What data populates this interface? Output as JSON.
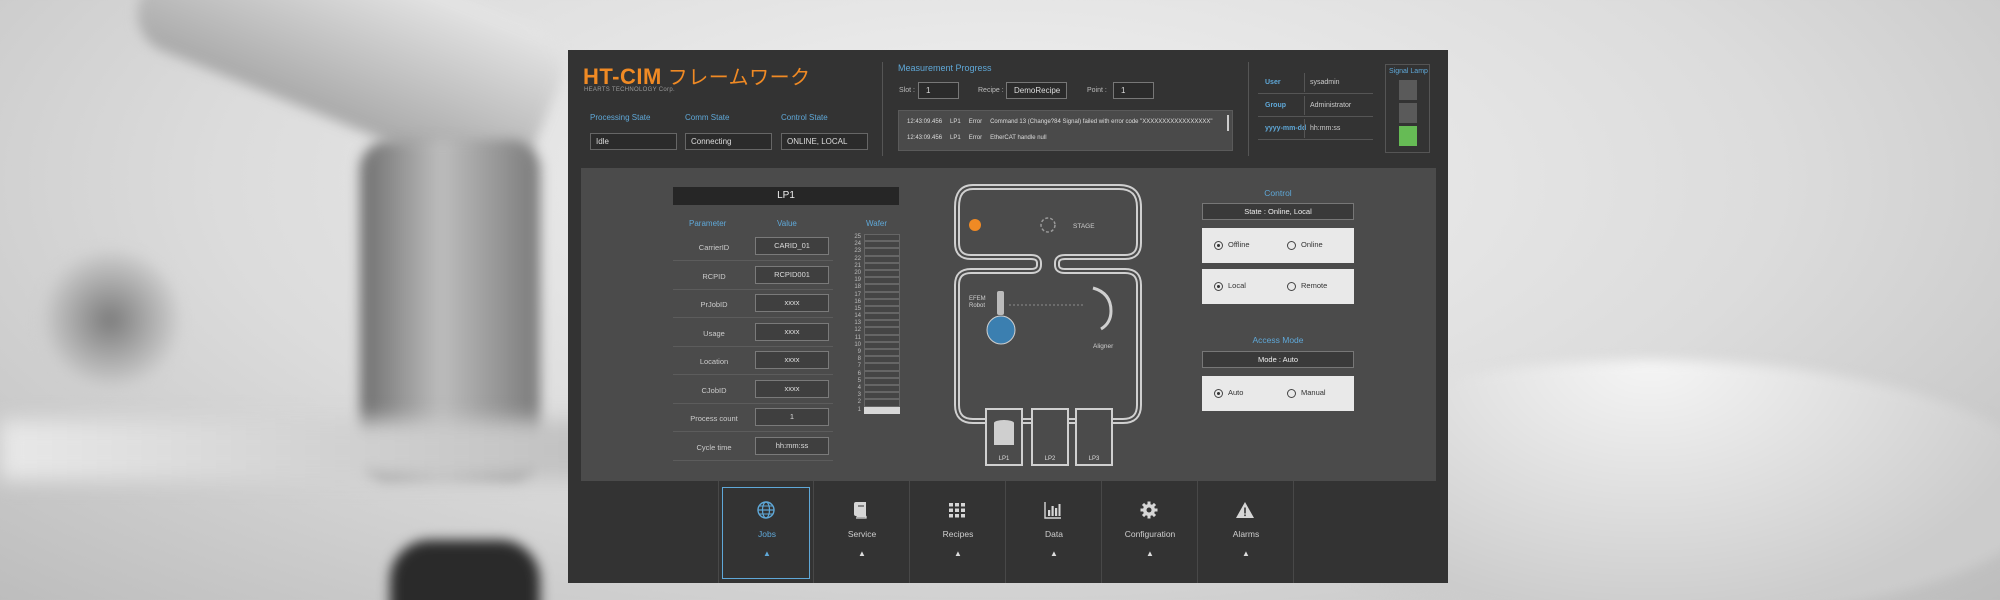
{
  "header": {
    "logo": "HT-CIM",
    "logo_jp": "フレームワーク",
    "logo_sub": "HEARTS TECHNOLOGY Corp.",
    "states": [
      {
        "label": "Processing State",
        "value": "Idle"
      },
      {
        "label": "Comm State",
        "value": "Connecting"
      },
      {
        "label": "Control State",
        "value": "ONLINE, LOCAL"
      }
    ]
  },
  "measurement": {
    "title": "Measurement Progress",
    "slot_label": "Slot :",
    "slot_value": "1",
    "recipe_label": "Recipe :",
    "recipe_value": "DemoRecipe",
    "point_label": "Point :",
    "point_value": "1",
    "log": [
      {
        "time": "12:43:09.456",
        "port": "LP1",
        "level": "Error",
        "message": "Command 13 (Change?84 Signal) failed with error code \"XXXXXXXXXXXXXXXXX\""
      },
      {
        "time": "12:43:09.456",
        "port": "LP1",
        "level": "Error",
        "message": "EtherCAT handle null"
      }
    ]
  },
  "user_info": [
    {
      "key": "User",
      "value": "sysadmin"
    },
    {
      "key": "Group",
      "value": "Administrator"
    },
    {
      "key": "yyyy-mm-dd",
      "value": "hh:mm:ss"
    }
  ],
  "signal_lamp": {
    "title": "Signal Lamp",
    "states": [
      "off",
      "off",
      "green"
    ],
    "green": "#66bb55",
    "off": "#5a5a5a"
  },
  "lp1": {
    "title": "LP1",
    "col_parameter": "Parameter",
    "col_value": "Value",
    "col_wafer": "Wafer",
    "params": [
      {
        "name": "CarrierID",
        "value": "CARID_01"
      },
      {
        "name": "RCPID",
        "value": "RCPID001"
      },
      {
        "name": "PrJobID",
        "value": "xxxx"
      },
      {
        "name": "Usage",
        "value": "xxxx"
      },
      {
        "name": "Location",
        "value": "xxxx"
      },
      {
        "name": "CJobID",
        "value": "xxxx"
      },
      {
        "name": "Process count",
        "value": "1"
      },
      {
        "name": "Cycle time",
        "value": "hh:mm:ss"
      }
    ],
    "wafer_slots": [
      "25",
      "24",
      "23",
      "22",
      "21",
      "20",
      "19",
      "18",
      "17",
      "16",
      "15",
      "14",
      "13",
      "12",
      "11",
      "10",
      "9",
      "8",
      "7",
      "6",
      "5",
      "4",
      "3",
      "2",
      "1"
    ],
    "filled_slots": [
      "1"
    ]
  },
  "diagram": {
    "stage_label": "STAGE",
    "robot_label_1": "EFEM",
    "robot_label_2": "Robot",
    "aligner_label": "Aligner",
    "ports": [
      "LP1",
      "LP2",
      "LP3"
    ],
    "accent": "#f08a24",
    "wafer_blue": "#3b7fb0"
  },
  "control": {
    "title": "Control",
    "state": "State : Online, Local",
    "online_group": {
      "a": "Offline",
      "b": "Online",
      "selected": "a"
    },
    "local_group": {
      "a": "Local",
      "b": "Remote",
      "selected": "a"
    },
    "access_title": "Access Mode",
    "mode": "Mode : Auto",
    "access_group": {
      "a": "Auto",
      "b": "Manual",
      "selected": "a"
    }
  },
  "nav": [
    {
      "label": "Jobs",
      "icon": "globe-icon",
      "active": true
    },
    {
      "label": "Service",
      "icon": "book-icon",
      "active": false
    },
    {
      "label": "Recipes",
      "icon": "grid-icon",
      "active": false
    },
    {
      "label": "Data",
      "icon": "bar-chart-icon",
      "active": false
    },
    {
      "label": "Configuration",
      "icon": "gear-icon",
      "active": false
    },
    {
      "label": "Alarms",
      "icon": "warning-icon",
      "active": false
    }
  ],
  "nav_caret": "▲"
}
